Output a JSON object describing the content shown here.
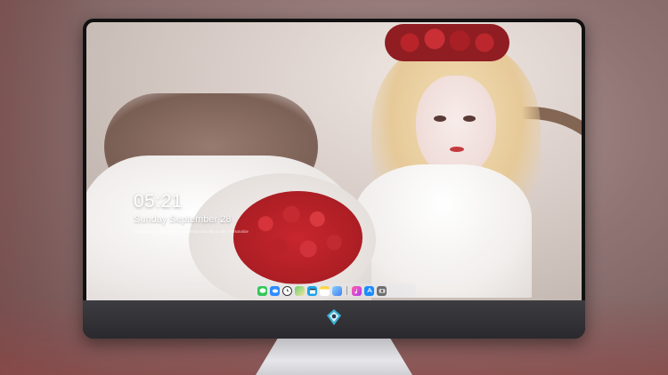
{
  "lockscreen": {
    "time": "05:21",
    "date": "Sunday September 28",
    "tagline": "Windows starts with you. Select Privacy·Security to rate · Personalize"
  },
  "dock": {
    "icons": [
      "messages-icon",
      "weather-cloud-icon",
      "clock-icon",
      "maps-icon",
      "video-clapper-icon",
      "notes-icon",
      "store-icon",
      "music-icon",
      "app-store-icon",
      "camera-icon"
    ]
  },
  "monitor": {
    "logo_icon": "diamond-logo-icon"
  },
  "colors": {
    "bezel": "#111111",
    "chin": "#2f2e33",
    "dock_bg": "rgba(230,230,235,0.45)",
    "text": "#ffffff"
  }
}
